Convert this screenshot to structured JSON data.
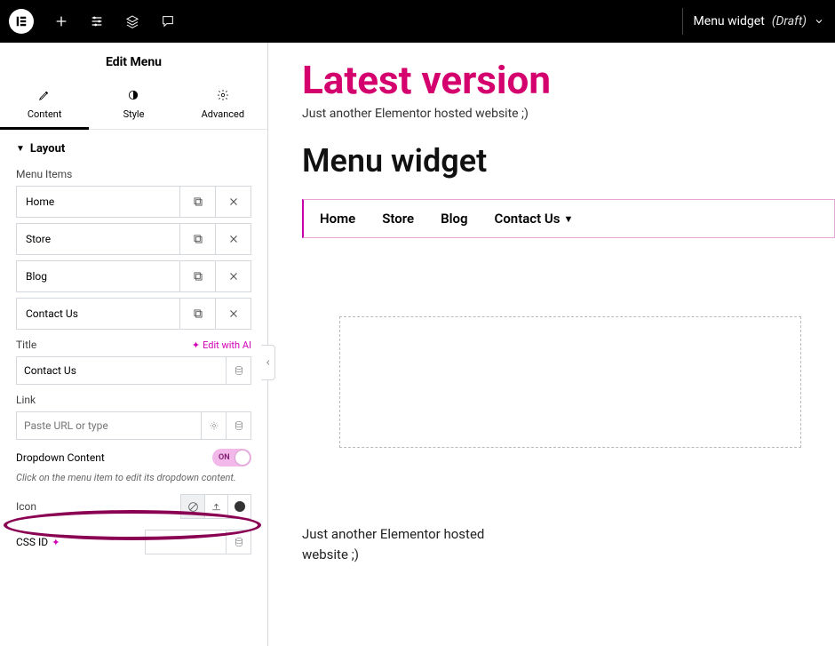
{
  "topbar": {
    "title": "Menu widget",
    "status": "(Draft)"
  },
  "panel": {
    "title": "Edit Menu",
    "tabs": {
      "content": "Content",
      "style": "Style",
      "advanced": "Advanced"
    },
    "section_layout": "Layout",
    "menu_items_label": "Menu Items",
    "menu_items": [
      {
        "label": "Home"
      },
      {
        "label": "Store"
      },
      {
        "label": "Blog"
      },
      {
        "label": "Contact Us"
      }
    ],
    "edit_ai": "Edit with AI",
    "title_label": "Title",
    "title_value": "Contact Us",
    "link_label": "Link",
    "link_placeholder": "Paste URL or type",
    "dropdown_label": "Dropdown Content",
    "toggle_on": "ON",
    "hint": "Click on the menu item to edit its dropdown content.",
    "icon_label": "Icon",
    "cssid_label": "CSS ID"
  },
  "preview": {
    "site_title": "Latest version",
    "site_tagline": "Just another Elementor hosted website ;)",
    "page_title": "Menu widget",
    "menu": [
      {
        "label": "Home",
        "has_dropdown": false
      },
      {
        "label": "Store",
        "has_dropdown": false
      },
      {
        "label": "Blog",
        "has_dropdown": false
      },
      {
        "label": "Contact Us",
        "has_dropdown": true
      }
    ],
    "footer_text": "Just another Elementor hosted website ;)"
  },
  "colors": {
    "accent": "#d4006e",
    "magenta": "#c800a8"
  }
}
